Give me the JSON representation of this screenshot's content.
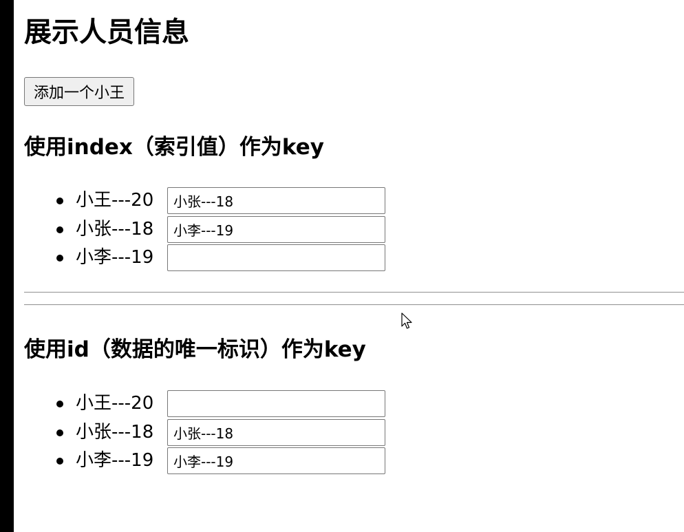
{
  "page_title": "展示人员信息",
  "add_button_label": "添加一个小王",
  "section_index": {
    "heading": "使用index（索引值）作为key",
    "items": [
      {
        "label": "小王---20",
        "input_value": "小张---18"
      },
      {
        "label": "小张---18",
        "input_value": "小李---19"
      },
      {
        "label": "小李---19",
        "input_value": ""
      }
    ]
  },
  "section_id": {
    "heading": "使用id（数据的唯一标识）作为key",
    "items": [
      {
        "label": "小王---20",
        "input_value": ""
      },
      {
        "label": "小张---18",
        "input_value": "小张---18"
      },
      {
        "label": "小李---19",
        "input_value": "小李---19"
      }
    ]
  },
  "icons": {
    "cursor": "mouse-pointer-icon",
    "bullet": "bullet-dot-icon"
  }
}
